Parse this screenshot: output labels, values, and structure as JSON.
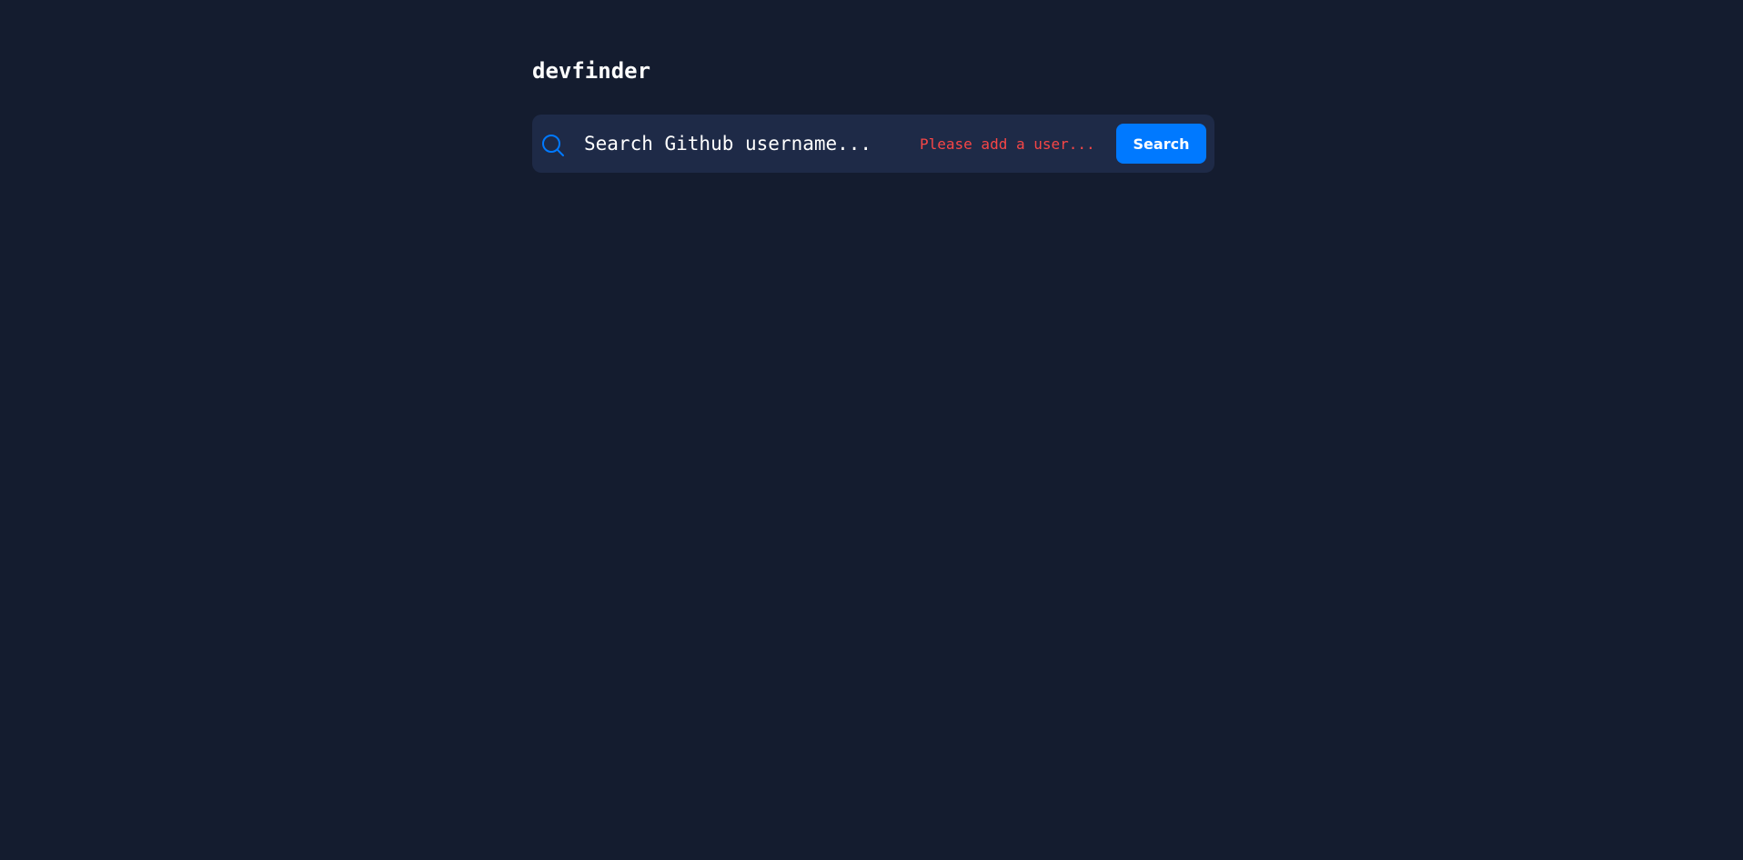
{
  "app": {
    "title": "devfinder"
  },
  "search": {
    "placeholder": "Search Github username...",
    "value": "",
    "error_message": "Please add a user...",
    "button_label": "Search",
    "icon": "search-icon"
  },
  "colors": {
    "background": "#141c2f",
    "panel": "#1e2a47",
    "accent": "#0079ff",
    "error": "#f74646",
    "text": "#ffffff"
  }
}
